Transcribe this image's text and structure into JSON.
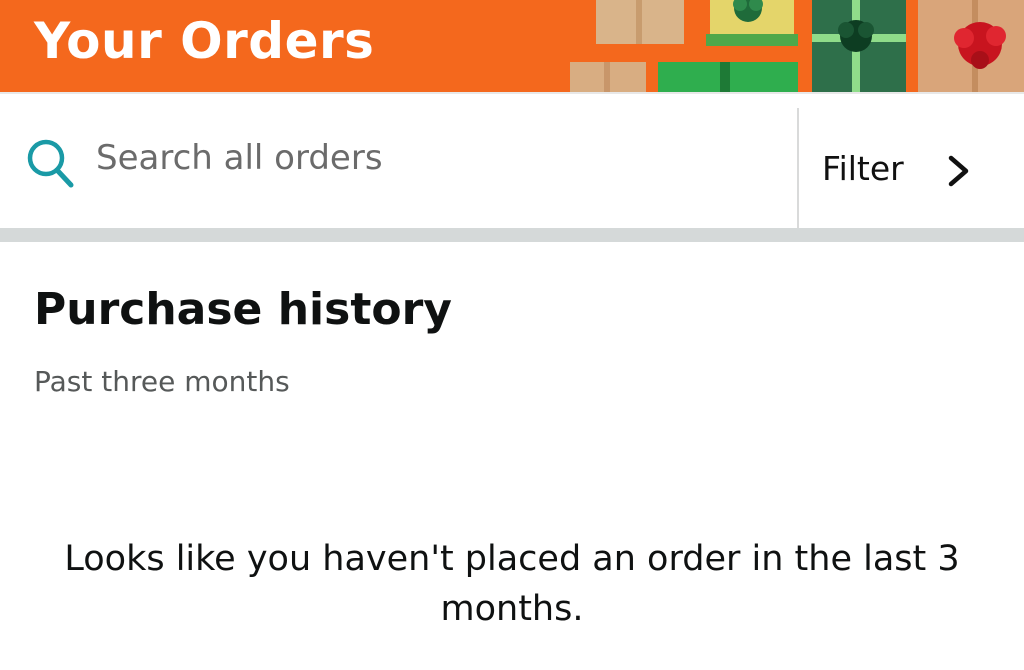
{
  "header": {
    "title": "Your Orders",
    "banner_color": "#f4681d",
    "banner_art": "holiday-gift-boxes"
  },
  "search": {
    "placeholder": "Search all orders",
    "icon": "search-icon",
    "icon_color": "#1a9aa6"
  },
  "filter": {
    "label": "Filter",
    "icon": "chevron-right-icon"
  },
  "purchase_history": {
    "title": "Purchase history",
    "subtitle": "Past three months",
    "empty_message": "Looks like you haven't placed an order in the last 3 months."
  }
}
